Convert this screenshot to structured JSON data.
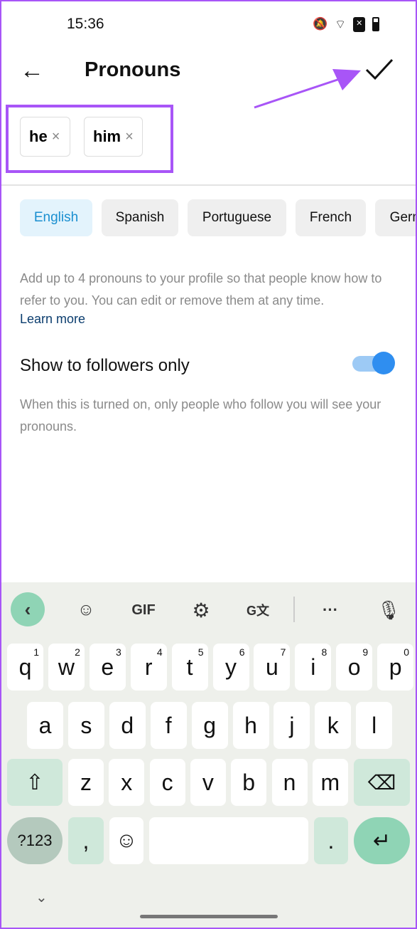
{
  "status_bar": {
    "time": "15:36",
    "icons": [
      "swiggy-icon",
      "reddit-icon",
      "gmail-icon",
      "bell-off-icon",
      "wifi-icon",
      "sim-x-icon",
      "battery-icon"
    ]
  },
  "header": {
    "title": "Pronouns",
    "back": "back-arrow-icon",
    "confirm": "check-icon"
  },
  "selected_pronouns": [
    {
      "label": "he",
      "remove": "×"
    },
    {
      "label": "him",
      "remove": "×"
    }
  ],
  "languages": [
    {
      "label": "English",
      "selected": true
    },
    {
      "label": "Spanish"
    },
    {
      "label": "Portuguese"
    },
    {
      "label": "French"
    },
    {
      "label": "German"
    }
  ],
  "description": "Add up to 4 pronouns to your profile so that people know how to refer to you. You can edit or remove them at any time.",
  "learn_more": "Learn more",
  "followers_toggle": {
    "label": "Show to followers only",
    "on": true,
    "description": "When this is turned on, only people who follow you will see your pronouns."
  },
  "keyboard": {
    "toolbar": {
      "gif": "GIF"
    },
    "row1": [
      [
        "q",
        "1"
      ],
      [
        "w",
        "2"
      ],
      [
        "e",
        "3"
      ],
      [
        "r",
        "4"
      ],
      [
        "t",
        "5"
      ],
      [
        "y",
        "6"
      ],
      [
        "u",
        "7"
      ],
      [
        "i",
        "8"
      ],
      [
        "o",
        "9"
      ],
      [
        "p",
        "0"
      ]
    ],
    "row2": [
      "a",
      "s",
      "d",
      "f",
      "g",
      "h",
      "j",
      "k",
      "l"
    ],
    "row3": [
      "z",
      "x",
      "c",
      "v",
      "b",
      "n",
      "m"
    ],
    "symbols": "?123",
    "comma": ",",
    "period": ".",
    "accent": "#8fd4b5"
  },
  "annotation_color": "#a855f7"
}
